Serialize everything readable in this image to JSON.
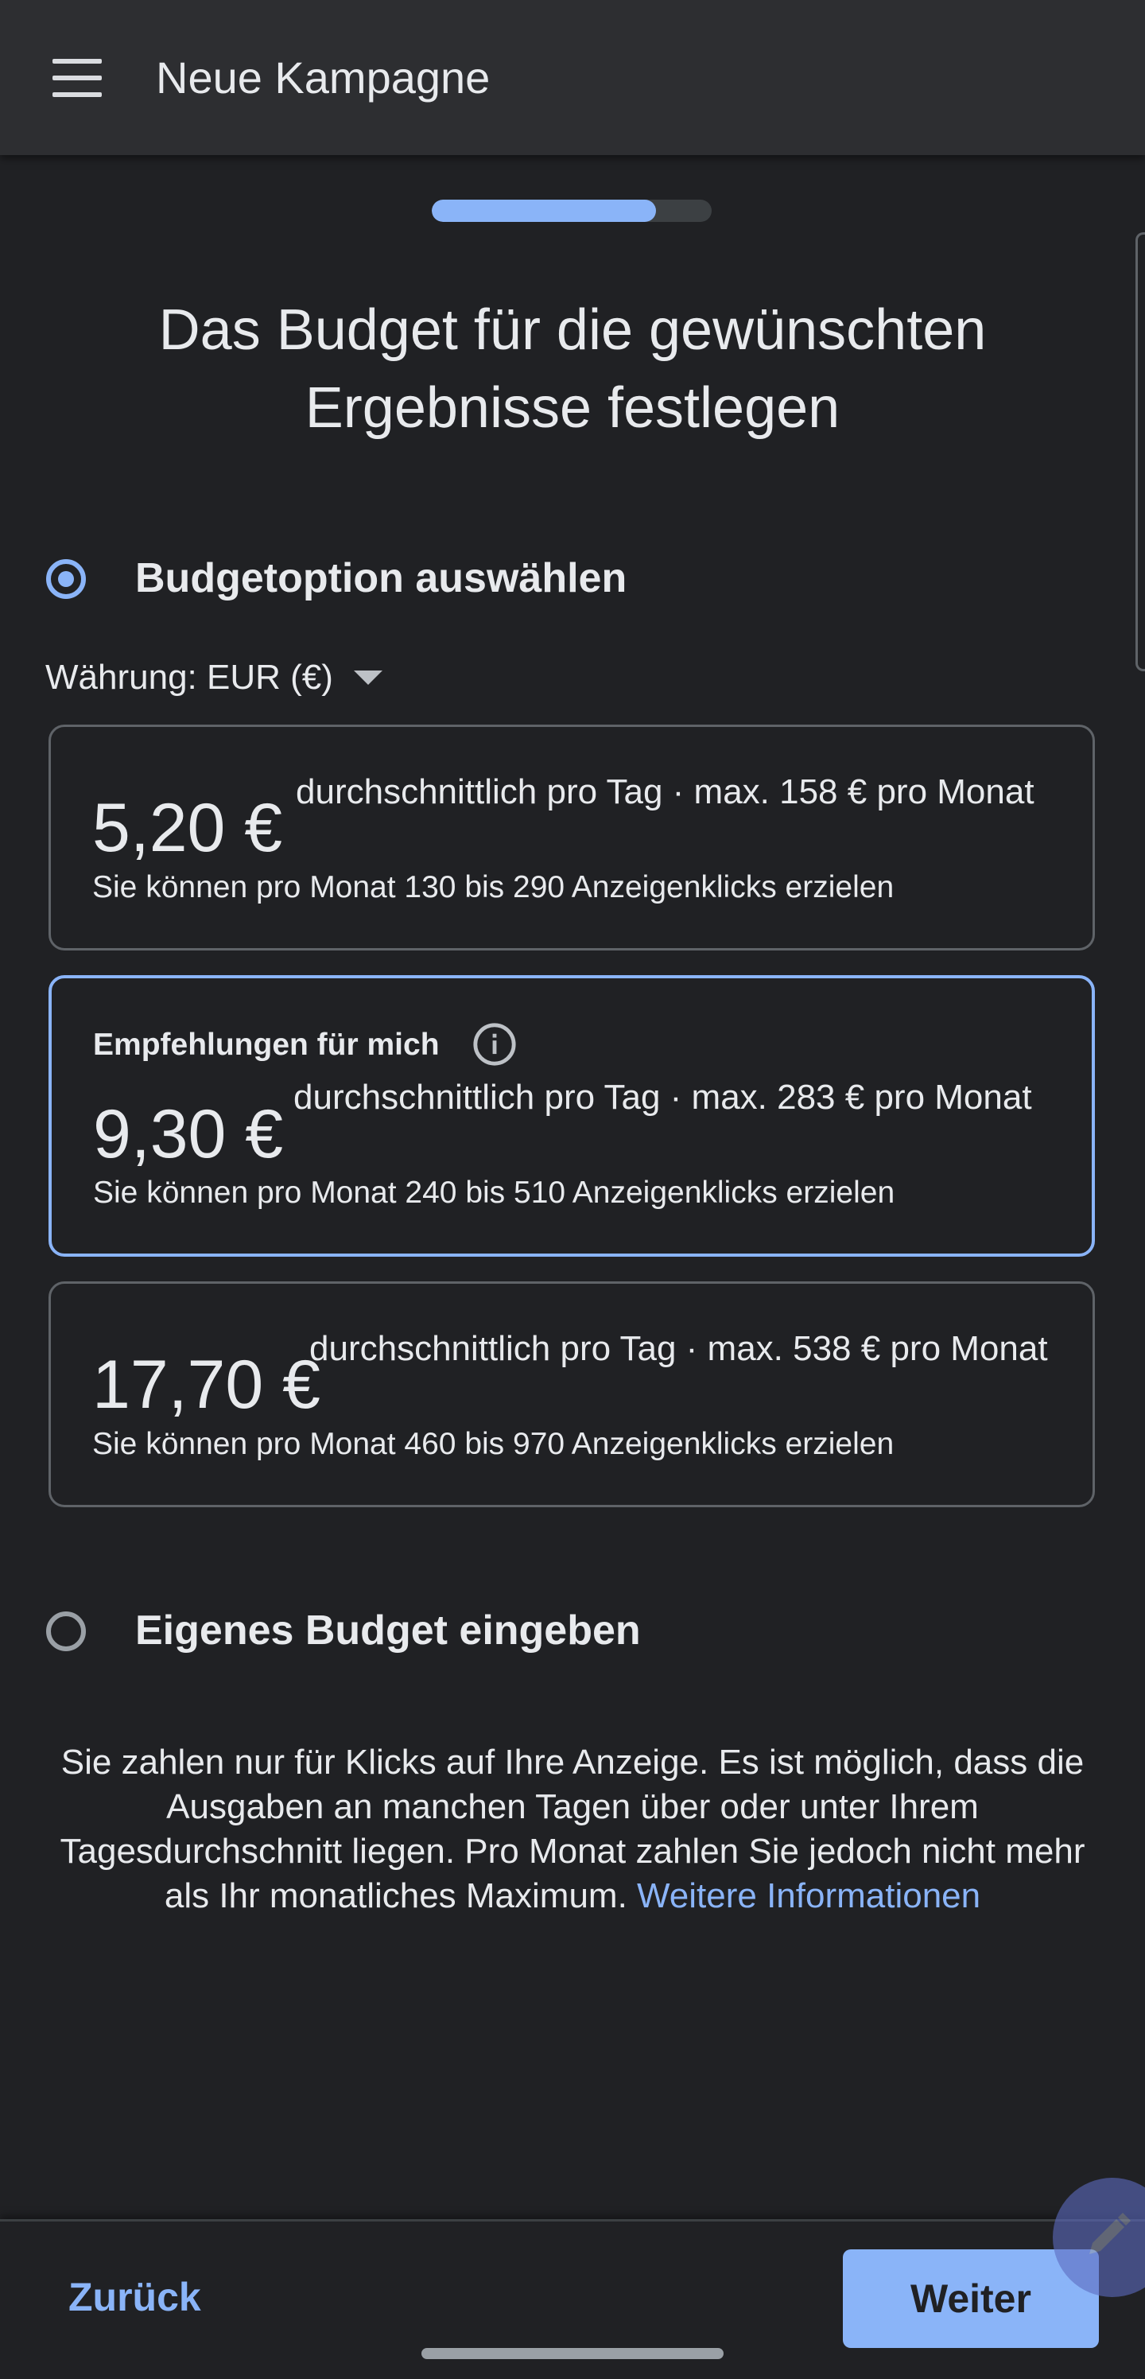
{
  "appbar": {
    "title": "Neue Kampagne"
  },
  "progress": {
    "value": 0.8
  },
  "headline": {
    "line1": "Das Budget für die gewünschten",
    "line2": "Ergebnisse festlegen"
  },
  "budget_option": {
    "label": "Budgetoption auswählen",
    "selected": true
  },
  "currency": {
    "label": "Währung: EUR (€)"
  },
  "options": [
    {
      "amount": "5,20 €",
      "desc": "durchschnittlich pro Tag · max. 158 € pro Monat",
      "clicks": "Sie können pro Monat 130 bis 290 Anzeigenklicks erzielen",
      "recommended_label": ""
    },
    {
      "amount": "9,30 €",
      "desc": "durchschnittlich pro Tag · max. 283 € pro Monat",
      "clicks": "Sie können pro Monat 240 bis 510 Anzeigenklicks erzielen",
      "recommended_label": "Empfehlungen für mich"
    },
    {
      "amount": "17,70 €",
      "desc": "durchschnittlich pro Tag · max. 538 € pro Monat",
      "clicks": "Sie können pro Monat 460 bis 970 Anzeigenklicks erzielen",
      "recommended_label": ""
    }
  ],
  "custom_budget": {
    "label": "Eigenes Budget eingeben",
    "selected": false
  },
  "note": {
    "text": "Sie zahlen nur für Klicks auf Ihre Anzeige. Es ist möglich, dass die Ausgaben an manchen Tagen über oder unter Ihrem Tagesdurchschnitt liegen. Pro Monat zahlen Sie jedoch nicht mehr als Ihr monatliches Maximum.",
    "link": "Weitere Informationen"
  },
  "footer": {
    "back": "Zurück",
    "next": "Weiter"
  },
  "icons": {
    "menu": "menu-icon",
    "info": "info-icon",
    "caret": "dropdown-arrow-icon",
    "fab": "edit-pen-icon"
  },
  "colors": {
    "background": "#202124",
    "appbar": "#2d2e31",
    "accent": "#8ab4f8",
    "text": "#e8eaed",
    "border": "#5f6368"
  }
}
